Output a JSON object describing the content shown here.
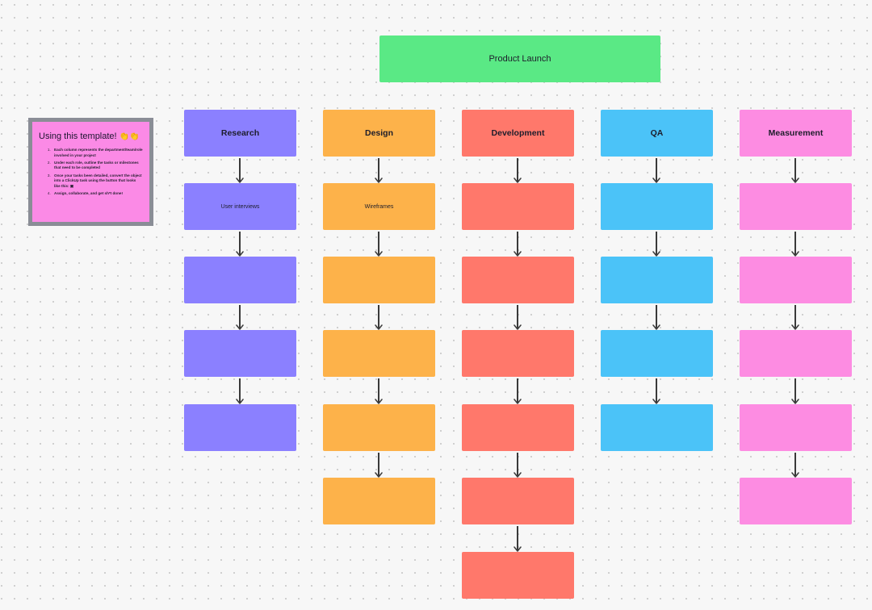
{
  "root": {
    "label": "Product Launch",
    "color": "#5ae985"
  },
  "note": {
    "title": "Using this template!",
    "emoji": "👏👏",
    "items": [
      "Each column represents the department/team/role involved in your project",
      "Under each role, outline the tasks or milestones that need to be completed",
      "Once your tasks been detailed, convert the object into a ClickUp task using the button that looks like this: ▣",
      "Assign, collaborate, and get sh*t done!"
    ]
  },
  "columns": [
    {
      "header": "Research",
      "color": "#8b80ff",
      "items": [
        "User interviews",
        "",
        "",
        ""
      ]
    },
    {
      "header": "Design",
      "color": "#fdb24a",
      "items": [
        "Wireframes",
        "",
        "",
        "",
        ""
      ]
    },
    {
      "header": "Development",
      "color": "#ff786b",
      "items": [
        "",
        "",
        "",
        "",
        "",
        ""
      ]
    },
    {
      "header": "QA",
      "color": "#4bc3f8",
      "items": [
        "",
        "",
        "",
        ""
      ]
    },
    {
      "header": "Measurement",
      "color": "#fd8ce2",
      "items": [
        "",
        "",
        "",
        "",
        ""
      ]
    }
  ]
}
